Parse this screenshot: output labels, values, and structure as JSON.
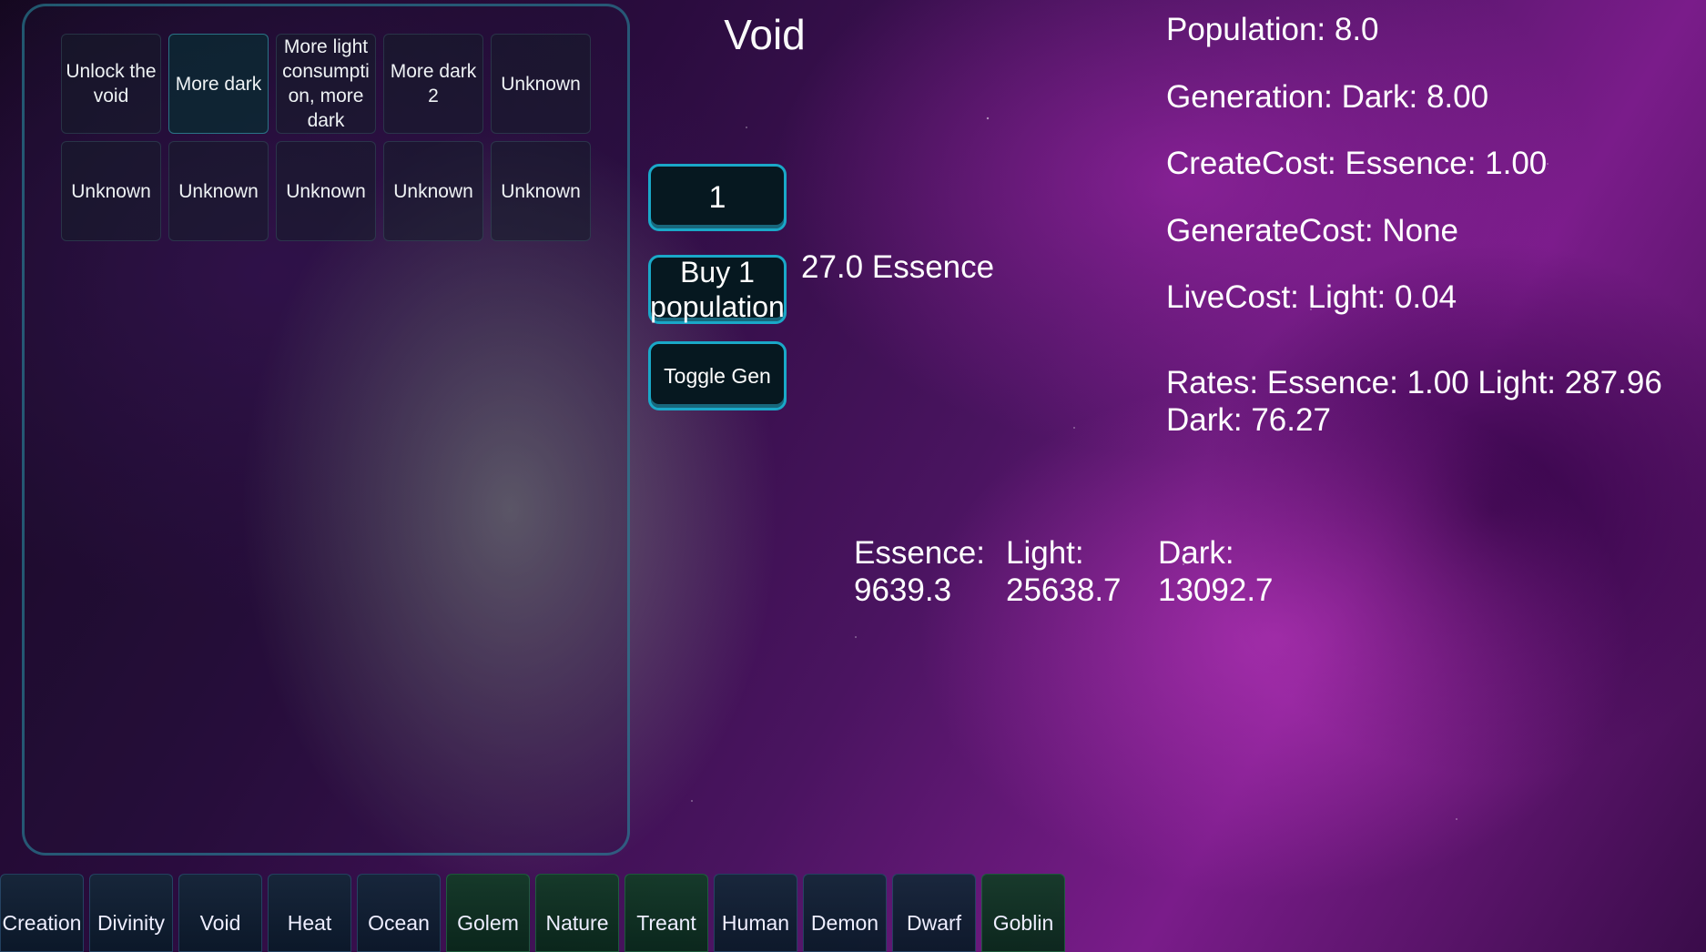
{
  "upgrades": [
    {
      "label": "Unlock the void",
      "active": false
    },
    {
      "label": "More dark",
      "active": true
    },
    {
      "label": "More light consumpti on, more dark",
      "active": false
    },
    {
      "label": "More dark 2",
      "active": false
    },
    {
      "label": "Unknown",
      "active": false
    },
    {
      "label": "Unknown",
      "active": false
    },
    {
      "label": "Unknown",
      "active": false
    },
    {
      "label": "Unknown",
      "active": false
    },
    {
      "label": "Unknown",
      "active": false
    },
    {
      "label": "Unknown",
      "active": false
    }
  ],
  "title": "Void",
  "controls": {
    "quantity": "1",
    "buy_label": "Buy 1 population",
    "toggle_label": "Toggle Gen",
    "price": "27.0 Essence"
  },
  "stats": {
    "population": "Population: 8.0",
    "generation": "Generation: Dark: 8.00",
    "create_cost": "CreateCost: Essence: 1.00",
    "generate_cost": "GenerateCost: None",
    "live_cost": "LiveCost: Light: 0.04",
    "rates": "Rates: Essence: 1.00 Light: 287.96 Dark: 76.27"
  },
  "resources": {
    "essence": {
      "label": "Essence:",
      "value": "9639.3"
    },
    "light": {
      "label": "Light:",
      "value": "25638.7"
    },
    "dark": {
      "label": "Dark:",
      "value": "13092.7"
    }
  },
  "tabs": [
    {
      "label": "Creation",
      "color": "blue"
    },
    {
      "label": "Divinity",
      "color": "blue"
    },
    {
      "label": "Void",
      "color": "blue"
    },
    {
      "label": "Heat",
      "color": "blue"
    },
    {
      "label": "Ocean",
      "color": "blue"
    },
    {
      "label": "Golem",
      "color": "green"
    },
    {
      "label": "Nature",
      "color": "green"
    },
    {
      "label": "Treant",
      "color": "green"
    },
    {
      "label": "Human",
      "color": "blue"
    },
    {
      "label": "Demon",
      "color": "blue"
    },
    {
      "label": "Dwarf",
      "color": "blue"
    },
    {
      "label": "Goblin",
      "color": "green"
    }
  ],
  "colors": {
    "accent": "#1aa8c8",
    "tab_green": "#0f3a25",
    "tab_blue": "#142838"
  }
}
